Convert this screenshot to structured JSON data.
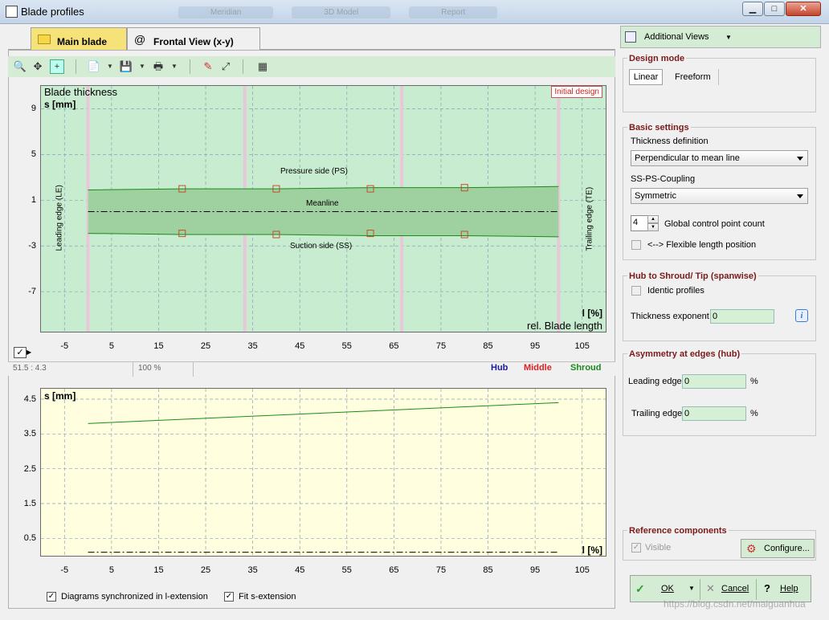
{
  "window": {
    "title": "Blade profiles",
    "ghost_tabs": [
      "Meridian",
      "3D Model",
      "Report"
    ]
  },
  "tabs": [
    {
      "label": "Main blade",
      "active": true
    },
    {
      "label": "Frontal View (x-y)",
      "active": false
    }
  ],
  "right_panel": {
    "additional_views": "Additional Views",
    "design_mode": {
      "title": "Design mode",
      "tabs": [
        "Linear",
        "Freeform"
      ],
      "selected": "Linear"
    },
    "basic_settings": {
      "title": "Basic settings",
      "thickness_definition_label": "Thickness definition",
      "thickness_definition_value": "Perpendicular to mean line",
      "ss_ps_coupling_label": "SS-PS-Coupling",
      "ss_ps_coupling_value": "Symmetric",
      "control_point_count": "4",
      "control_point_label": "Global control point count",
      "flexible_length_label": "<--> Flexible length position"
    },
    "hub_shroud": {
      "title": "Hub to Shroud/ Tip (spanwise)",
      "identic_profiles_label": "Identic profiles",
      "thickness_exponent_label": "Thickness exponent",
      "thickness_exponent_value": "0"
    },
    "asymmetry": {
      "title": "Asymmetry at edges (hub)",
      "leading_edge_label": "Leading edge",
      "leading_edge_value": "0",
      "trailing_edge_label": "Trailing edge",
      "trailing_edge_value": "0",
      "unit": "%"
    },
    "reference": {
      "title": "Reference components",
      "visible_label": "Visible",
      "configure_label": "Configure..."
    },
    "buttons": {
      "ok": "OK",
      "cancel": "Cancel",
      "help": "Help"
    }
  },
  "status": {
    "coords": "51.5 : 4.3",
    "zoom": "100 %",
    "legend_hub": "Hub",
    "legend_middle": "Middle",
    "legend_shroud": "Shroud"
  },
  "bottom": {
    "sync_label": "Diagrams synchronized in l-extension",
    "fit_label": "Fit s-extension"
  },
  "watermark": "https://blog.csdn.net/maiguanhua",
  "colors": {
    "hub": "#1a1aa0",
    "middle": "#e02020",
    "shroud": "#1a8a1a",
    "chart1_bg": "#c8ecd0",
    "chart2_bg": "#ffffe0"
  },
  "chart_data": [
    {
      "type": "line",
      "title": "Blade thickness",
      "badge": "Initial design",
      "ylabel": "s [mm]",
      "xlabel_unit": "l [%]",
      "xlabel": "rel. Blade length",
      "xlim": [
        -10,
        110
      ],
      "ylim": [
        -10.5,
        11
      ],
      "xticks": [
        -5,
        5,
        15,
        25,
        35,
        45,
        55,
        65,
        75,
        85,
        95,
        105
      ],
      "yticks": [
        9,
        5,
        1,
        -3,
        -7
      ],
      "annotations": {
        "ps": "Pressure side (PS)",
        "ss": "Suction side (SS)",
        "mean": "Meanline",
        "le": "Leading edge (LE)",
        "te": "Trailing edge (TE)"
      },
      "series": [
        {
          "name": "Pressure side (PS)",
          "x": [
            0,
            20,
            40,
            60,
            80,
            100
          ],
          "y": [
            1.9,
            2.0,
            2.0,
            2.1,
            2.1,
            2.2
          ]
        },
        {
          "name": "Suction side (SS)",
          "x": [
            0,
            20,
            40,
            60,
            80,
            100
          ],
          "y": [
            -1.9,
            -2.0,
            -2.0,
            -2.1,
            -2.1,
            -2.2
          ]
        },
        {
          "name": "Meanline",
          "x": [
            0,
            100
          ],
          "y": [
            0,
            0
          ]
        }
      ],
      "control_points": {
        "x": [
          20,
          40,
          60,
          80
        ],
        "ps_y": [
          2.0,
          2.0,
          2.0,
          2.1
        ],
        "ss_y": [
          -1.9,
          -2.0,
          -1.9,
          -2.0
        ]
      }
    },
    {
      "type": "line",
      "ylabel": "s [mm]",
      "xlabel_unit": "l [%]",
      "xlim": [
        -10,
        110
      ],
      "ylim": [
        0,
        4.8
      ],
      "xticks": [
        -5,
        5,
        15,
        25,
        35,
        45,
        55,
        65,
        75,
        85,
        95,
        105
      ],
      "yticks": [
        4.5,
        3.5,
        2.5,
        1.5,
        0.5
      ],
      "series": [
        {
          "x": [
            0,
            100
          ],
          "y": [
            3.8,
            4.4
          ]
        },
        {
          "x": [
            0,
            100
          ],
          "y": [
            0.1,
            0.1
          ]
        }
      ]
    }
  ]
}
